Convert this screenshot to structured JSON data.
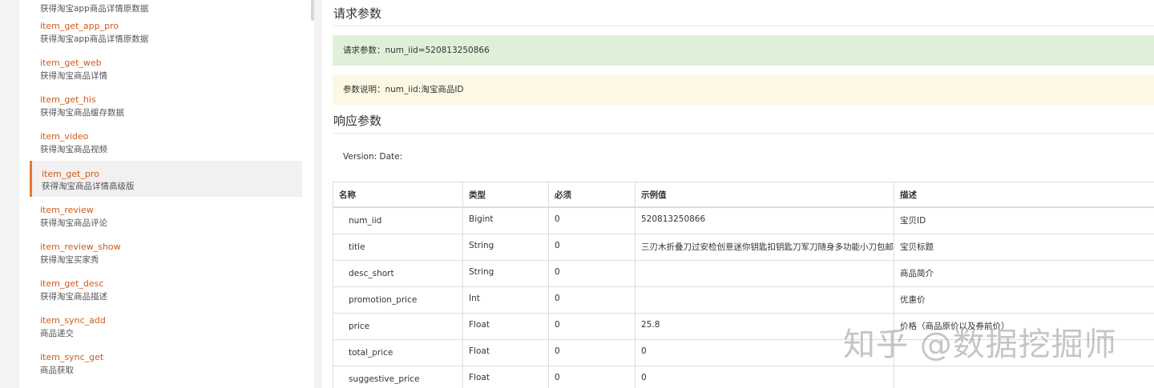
{
  "sidebar": {
    "partial_top": "获得淘宝app商品详情原数据",
    "items": [
      {
        "name": "item_get_app_pro",
        "desc": "获得淘宝app商品详情原数据"
      },
      {
        "name": "item_get_web",
        "desc": "获得淘宝商品详情"
      },
      {
        "name": "item_get_his",
        "desc": "获得淘宝商品缓存数据"
      },
      {
        "name": "item_video",
        "desc": "获得淘宝商品视频"
      },
      {
        "name": "item_get_pro",
        "desc": "获得淘宝商品详情高级版"
      },
      {
        "name": "item_review",
        "desc": "获得淘宝商品评论"
      },
      {
        "name": "item_review_show",
        "desc": "获得淘宝买家秀"
      },
      {
        "name": "item_get_desc",
        "desc": "获得淘宝商品描述"
      },
      {
        "name": "item_sync_add",
        "desc": "商品递交"
      },
      {
        "name": "item_sync_get",
        "desc": "商品获取"
      }
    ]
  },
  "request": {
    "title": "请求参数",
    "params": "请求参数：num_iid=520813250866",
    "explain": "参数说明：num_iid:淘宝商品ID"
  },
  "response": {
    "title": "响应参数",
    "version": "Version: Date:"
  },
  "table": {
    "headers": [
      "名称",
      "类型",
      "必须",
      "示例值",
      "描述"
    ],
    "rows": [
      [
        "num_iid",
        "Bigint",
        "0",
        "520813250866",
        "宝贝ID"
      ],
      [
        "title",
        "String",
        "0",
        "三刃木折叠刀过安检创意迷你钥匙扣钥匙刀军刀随身多功能小刀包邮",
        "宝贝标题"
      ],
      [
        "desc_short",
        "String",
        "0",
        "",
        "商品简介"
      ],
      [
        "promotion_price",
        "Int",
        "0",
        "",
        "优惠价"
      ],
      [
        "price",
        "Float",
        "0",
        "25.8",
        "价格（商品原价以及券前价）"
      ],
      [
        "total_price",
        "Float",
        "0",
        "0",
        ""
      ],
      [
        "suggestive_price",
        "Float",
        "0",
        "0",
        ""
      ]
    ]
  },
  "watermark": "知乎 @数据挖掘师"
}
